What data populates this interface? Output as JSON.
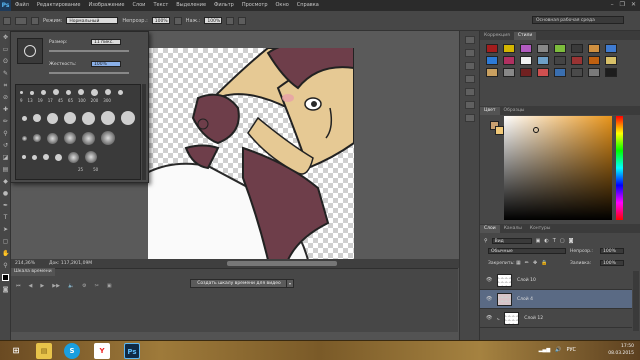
{
  "app": {
    "logo": "Ps"
  },
  "menu": [
    "Файл",
    "Редактирование",
    "Изображение",
    "Слои",
    "Текст",
    "Выделение",
    "Фильтр",
    "Просмотр",
    "Окно",
    "Справка"
  ],
  "options": {
    "mode_label": "Режим:",
    "mode_value": "Нормальный",
    "opacity_label": "Непрозр.:",
    "opacity_value": "100%",
    "pressure_label": "Наж.:",
    "pressure_value": "100%"
  },
  "workspace": "Основная рабочая среда",
  "brush_panel": {
    "size_label": "Размер:",
    "size_value": "11 пикс.",
    "hardness_label": "Жесткость:",
    "hardness_value": "100%",
    "row1_sizes": [
      "9",
      "13",
      "19",
      "17",
      "45",
      "65",
      "100",
      "200",
      "300"
    ],
    "bottom_sizes": [
      "25",
      "50"
    ]
  },
  "status": {
    "zoom": "214,36%",
    "doc": "Док: 117,2K/1,09M"
  },
  "timeline": {
    "tab": "Шкала времени",
    "create_button": "Создать шкалу времени для видео"
  },
  "swatches_panel": {
    "tabs": [
      "Коррекция",
      "Стили"
    ],
    "colors": [
      "#a31d1d",
      "#d4b500",
      "#b25bc0",
      "#888888",
      "#7dbd3c",
      "#3a3a3a",
      "#d09040",
      "#3f7bd1",
      "#2d7ad6",
      "#b03060",
      "#f0f0f0",
      "#6ea0c8",
      "#444444",
      "#993333",
      "#c06010",
      "#d8c068",
      "#c9a060",
      "#888888",
      "#702020",
      "#d05050",
      "#3a6fb0",
      "#4a4a4a",
      "#7a7a7a",
      "#1d1d1d"
    ]
  },
  "color_panel": {
    "tabs": [
      "Цвет",
      "Образцы"
    ],
    "fg": "#c9a070",
    "bg": "#f0c878"
  },
  "layers_panel": {
    "tabs": [
      "Слои",
      "Каналы",
      "Контуры"
    ],
    "filter": "Вид",
    "blend": "Обычные",
    "opacity_label": "Непрозр.:",
    "opacity_value": "100%",
    "lock_label": "Закрепить:",
    "fill_label": "Заливка:",
    "fill_value": "100%",
    "layers": [
      {
        "name": "Слой 10",
        "selected": false
      },
      {
        "name": "Слой 4",
        "selected": true
      },
      {
        "name": "Слой 12",
        "selected": false
      }
    ]
  },
  "taskbar": {
    "lang": "РУС",
    "time": "17:50",
    "date": "08.03.2015"
  }
}
